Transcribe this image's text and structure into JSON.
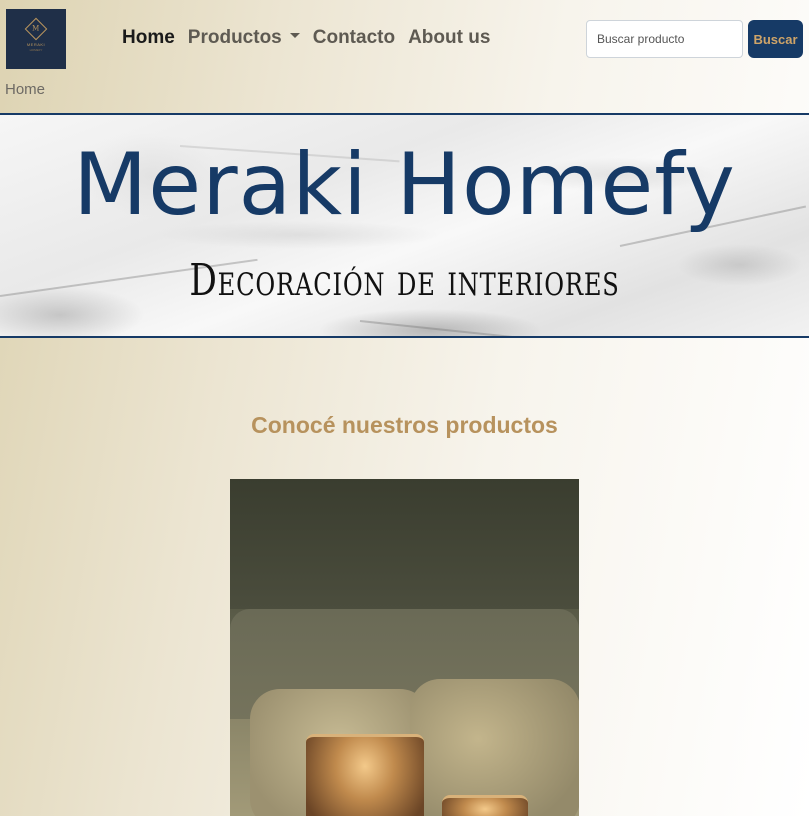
{
  "header": {
    "logo": {
      "alt": "Meraki logo",
      "mark": "M",
      "text": "MERAKI",
      "subtext": "HOMEFY"
    },
    "nav": [
      {
        "label": "Home",
        "active": true
      },
      {
        "label": "Productos",
        "dropdown": true
      },
      {
        "label": "Contacto"
      },
      {
        "label": "About us"
      }
    ],
    "search": {
      "placeholder": "Buscar producto",
      "value": "",
      "button_label": "Buscar"
    }
  },
  "breadcrumb": "Home",
  "banner": {
    "title": "Meraki Homefy",
    "subtitle": "Decoración de interiores"
  },
  "main": {
    "section_title": "Conocé nuestros productos",
    "product_image": "candles-on-sofa-photo"
  },
  "colors": {
    "brand_navy": "#163a66",
    "brand_gold": "#b7925d",
    "button_text": "#cfa468"
  }
}
